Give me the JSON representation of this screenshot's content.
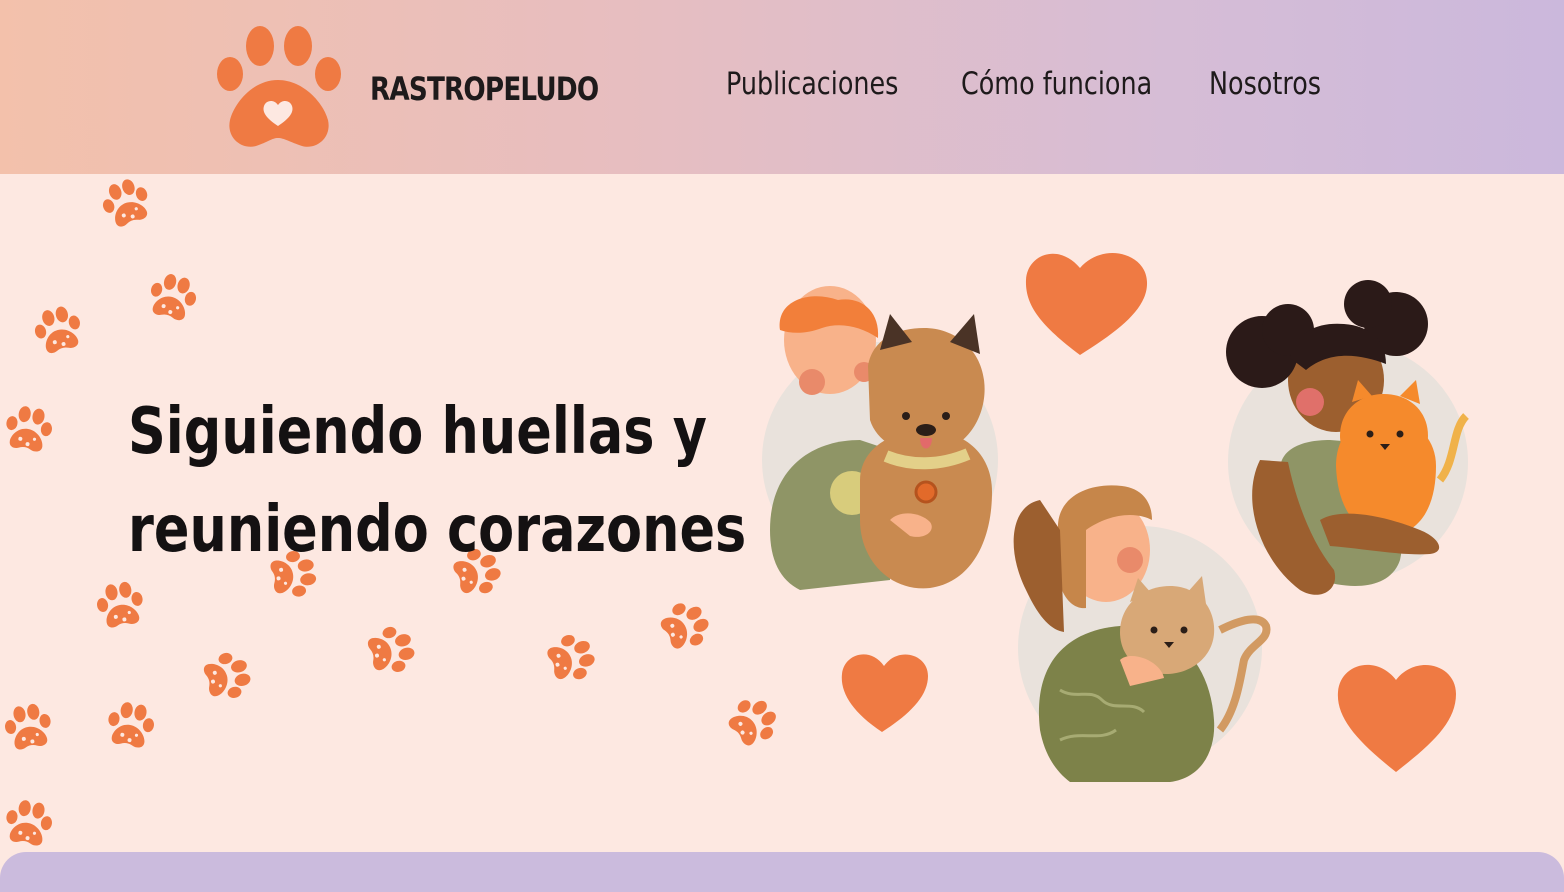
{
  "header": {
    "brand": "RASTROPELUDO",
    "logo_icon": "paw-heart-icon",
    "nav": [
      {
        "label": "Publicaciones"
      },
      {
        "label": "Cómo funciona"
      },
      {
        "label": "Nosotros"
      }
    ]
  },
  "hero": {
    "headline_line1": "Siguiendo huellas y",
    "headline_line2": "reuniendo corazones",
    "illustration": "people-hugging-pets-illustration",
    "decoration_icon": "paw-print-icon"
  },
  "colors": {
    "accent": "#ef7a43",
    "hero_background": "#fde8e1",
    "header_gradient_start": "#f3c1ab",
    "header_gradient_end": "#cbb8dc",
    "footer_bar": "#cbbbdd",
    "text": "#1e1a1b"
  }
}
